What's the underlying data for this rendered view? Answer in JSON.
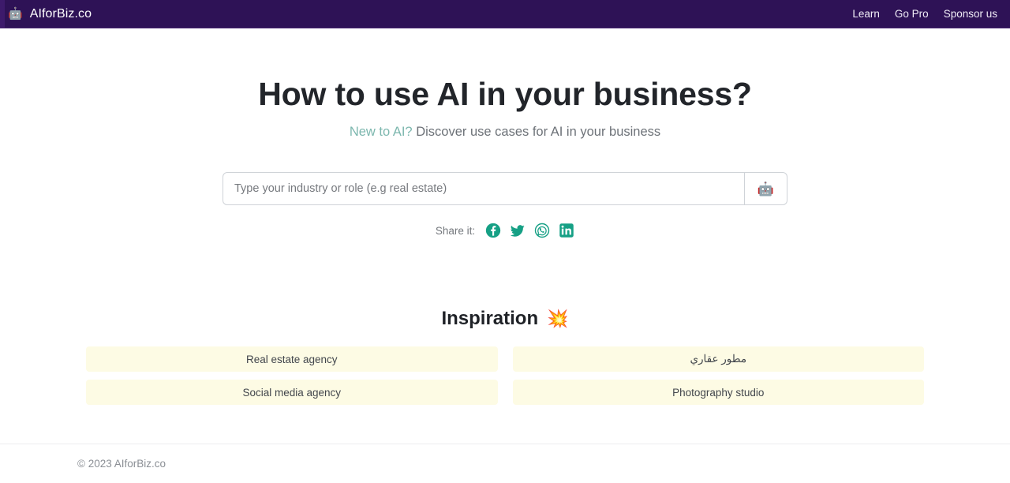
{
  "header": {
    "logo_icon": "robot-icon",
    "brand": "AIforBiz.co",
    "links": [
      {
        "label": "Learn"
      },
      {
        "label": "Go Pro"
      },
      {
        "label": "Sponsor us"
      }
    ],
    "background_color": "#2e1256"
  },
  "hero": {
    "title": "How to use AI in your business?",
    "subtitle_accent": "New to AI?",
    "subtitle_rest": " Discover use cases for AI in your business",
    "accent_color": "#7cb7ae"
  },
  "search": {
    "placeholder": "Type your industry or role (e.g real estate)",
    "value": "",
    "submit_icon": "robot-icon",
    "submit_glyph": "🤖"
  },
  "share": {
    "label": "Share it:",
    "color": "#16a085",
    "items": [
      {
        "name": "facebook-share-icon",
        "label": "Facebook"
      },
      {
        "name": "twitter-share-icon",
        "label": "Twitter"
      },
      {
        "name": "whatsapp-share-icon",
        "label": "WhatsApp"
      },
      {
        "name": "linkedin-share-icon",
        "label": "LinkedIn"
      }
    ]
  },
  "inspiration": {
    "heading": "Inspiration",
    "emoji": "💥",
    "cards": [
      {
        "label": "Real estate agency",
        "rtl": false
      },
      {
        "label": "مطور عقاري",
        "rtl": true
      },
      {
        "label": "Social media agency",
        "rtl": false
      },
      {
        "label": "Photography studio",
        "rtl": false
      }
    ]
  },
  "footer": {
    "copyright": "© 2023 AIforBiz.co"
  }
}
